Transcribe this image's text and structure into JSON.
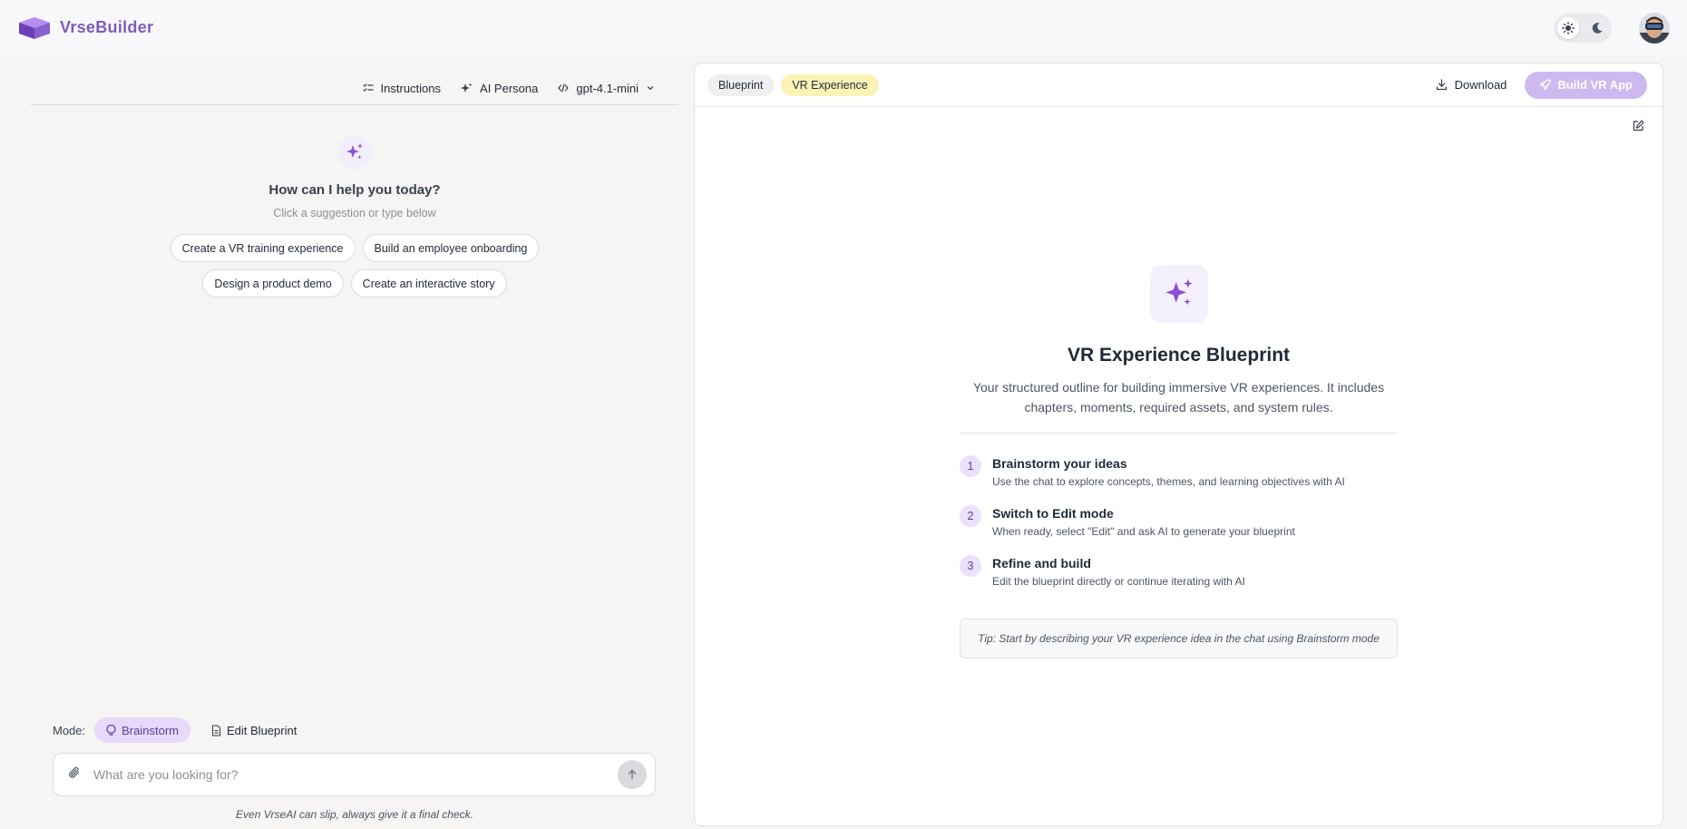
{
  "app": {
    "name": "VrseBuilder",
    "accent_color": "#7c5cbd"
  },
  "header": {
    "theme_toggle": {
      "light_icon": "sun-icon",
      "dark_icon": "moon-icon",
      "active": "light"
    },
    "avatar_icon": "user-avatar"
  },
  "chat": {
    "toolbar": {
      "instructions_label": "Instructions",
      "persona_label": "AI Persona",
      "model_label": "gpt-4.1-mini"
    },
    "welcome": {
      "title": "How can I help you today?",
      "subtitle": "Click a suggestion or type below"
    },
    "suggestions": [
      "Create a VR training experience",
      "Build an employee onboarding",
      "Design a product demo",
      "Create an interactive story"
    ],
    "mode": {
      "label": "Mode:",
      "brainstorm_label": "Brainstorm",
      "edit_label": "Edit Blueprint",
      "active": "brainstorm"
    },
    "input": {
      "placeholder": "What are you looking for?",
      "value": ""
    },
    "disclaimer": "Even VrseAI can slip, always give it a final check."
  },
  "blueprint": {
    "tabs": {
      "blueprint_label": "Blueprint",
      "vr_label": "VR Experience",
      "active": "vr"
    },
    "download_label": "Download",
    "build_label": "Build VR App",
    "empty_state": {
      "title": "VR Experience Blueprint",
      "description": "Your structured outline for building immersive VR experiences. It includes chapters, moments, required assets, and system rules.",
      "steps": [
        {
          "num": "1",
          "title": "Brainstorm your ideas",
          "desc": "Use the chat to explore concepts, themes, and learning objectives with AI"
        },
        {
          "num": "2",
          "title": "Switch to Edit mode",
          "desc": "When ready, select \"Edit\" and ask AI to generate your blueprint"
        },
        {
          "num": "3",
          "title": "Refine and build",
          "desc": "Edit the blueprint directly or continue iterating with AI"
        }
      ],
      "tip": "Tip: Start by describing your VR experience idea in the chat using Brainstorm mode"
    }
  }
}
